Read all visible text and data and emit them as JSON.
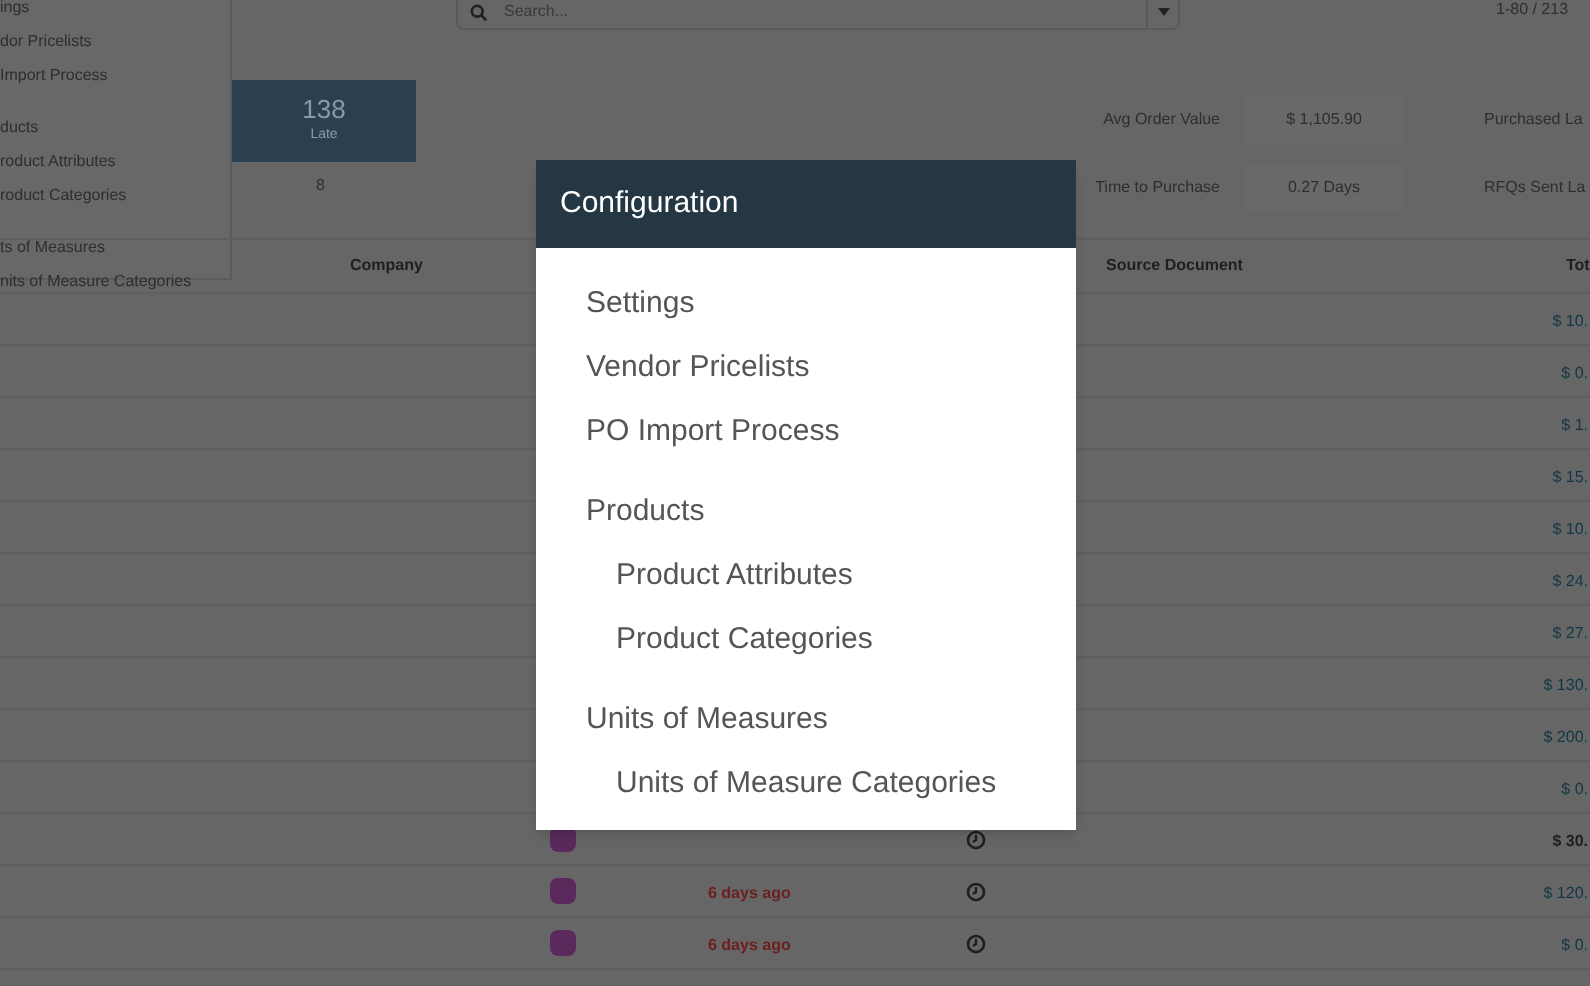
{
  "background_menu": {
    "items": [
      {
        "label": "ings",
        "kind": "item"
      },
      {
        "label": "dor Pricelists",
        "kind": "item"
      },
      {
        "label": "Import Process",
        "kind": "item"
      },
      {
        "label": "ducts",
        "kind": "header"
      },
      {
        "label": "roduct Attributes",
        "kind": "item"
      },
      {
        "label": "roduct Categories",
        "kind": "item"
      },
      {
        "label": "ts of Measures",
        "kind": "header"
      },
      {
        "label": "nits of Measure Categories",
        "kind": "item"
      }
    ]
  },
  "search": {
    "placeholder": "Search..."
  },
  "pager": "1-80 / 213",
  "late_tile": {
    "value": "138",
    "label": "Late",
    "below": "8"
  },
  "stats": [
    {
      "label": "Avg Order Value",
      "value": "$ 1,105.90",
      "next_label": "Purchased La"
    },
    {
      "label": "Time to Purchase",
      "value": "0.27 Days",
      "next_label": "RFQs Sent La"
    }
  ],
  "table": {
    "columns": [
      "Company",
      "Source Document",
      "Tot"
    ],
    "rows": [
      {
        "total": "$ 10.",
        "bold": false
      },
      {
        "total": "$ 0.",
        "bold": false
      },
      {
        "total": "$ 1.",
        "bold": false
      },
      {
        "total": "$ 15.",
        "bold": false
      },
      {
        "total": "$ 10.",
        "bold": false
      },
      {
        "total": "$ 24.",
        "bold": false
      },
      {
        "total": "$ 27.",
        "bold": false
      },
      {
        "total": "$ 130.",
        "bold": false
      },
      {
        "total": "$ 200.",
        "bold": false
      },
      {
        "total": "$ 0.",
        "bold": false
      },
      {
        "total": "$ 30.",
        "bold": true,
        "avatar": true
      },
      {
        "total": "$ 120.",
        "bold": false,
        "avatar": true,
        "date": "6 days ago"
      },
      {
        "total": "$ 0.",
        "bold": false,
        "avatar": true,
        "date": "6 days ago"
      }
    ]
  },
  "dialog": {
    "title": "Configuration",
    "items": [
      {
        "label": "Settings",
        "kind": "item"
      },
      {
        "label": "Vendor Pricelists",
        "kind": "item"
      },
      {
        "label": "PO Import Process",
        "kind": "item"
      },
      {
        "label": "Products",
        "kind": "header"
      },
      {
        "label": "Product Attributes",
        "kind": "sub"
      },
      {
        "label": "Product Categories",
        "kind": "sub"
      },
      {
        "label": "Units of Measures",
        "kind": "header"
      },
      {
        "label": "Units of Measure Categories",
        "kind": "sub"
      }
    ]
  }
}
